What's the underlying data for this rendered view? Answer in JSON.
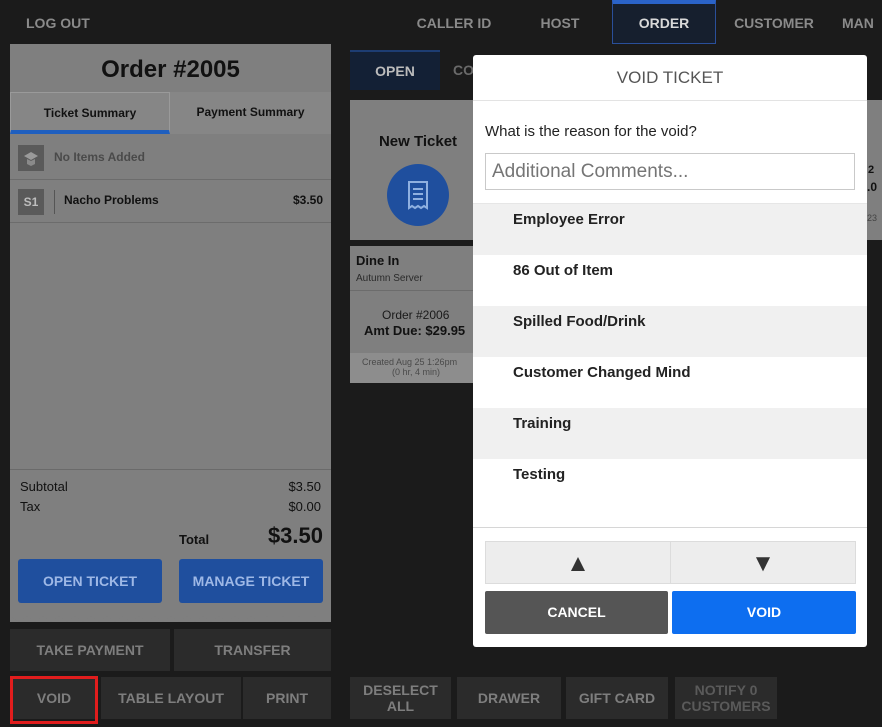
{
  "topnav": {
    "logout": "LOG OUT",
    "tabs": [
      {
        "label": "CALLER ID"
      },
      {
        "label": "HOST"
      },
      {
        "label": "ORDER"
      },
      {
        "label": "CUSTOMER"
      },
      {
        "label": "MAN"
      }
    ]
  },
  "ticket": {
    "title": "Order #2005",
    "tabs": [
      "Ticket Summary",
      "Payment Summary"
    ],
    "no_items": "No Items Added",
    "seat_label": "S1",
    "item_name": "Nacho Problems",
    "item_price": "$3.50",
    "subtotal_label": "Subtotal",
    "subtotal_value": "$3.50",
    "tax_label": "Tax",
    "tax_value": "$0.00",
    "total_label": "Total",
    "total_value": "$3.50",
    "open_ticket": "OPEN TICKET",
    "manage_ticket": "MANAGE TICKET"
  },
  "actions_left": {
    "take_payment": "TAKE PAYMENT",
    "transfer": "TRANSFER",
    "void": "VOID",
    "table_layout": "TABLE LAYOUT",
    "print": "PRINT"
  },
  "actions_right": {
    "deselect_all": "DESELECT ALL",
    "drawer": "DRAWER",
    "gift_card": "GIFT CARD",
    "notify_customers": "NOTIFY 0 CUSTOMERS"
  },
  "background": {
    "status_tab_open": "OPEN",
    "status_tab_partial": "CO",
    "new_ticket": "New Ticket",
    "dine_in": "Dine In",
    "server": "Autumn Server",
    "order_no": "Order #2006",
    "amt_due": "Amt Due: $29.95",
    "created": "Created Aug 25 1:26pm",
    "duration": "(0 hr, 4 min)",
    "partial_1": "2",
    "partial_2": ".0",
    "partial_3": "23"
  },
  "modal": {
    "title": "VOID TICKET",
    "question": "What is the reason for the void?",
    "comments_placeholder": "Additional Comments...",
    "reasons": [
      "Employee Error",
      "86 Out of Item",
      "Spilled Food/Drink",
      "Customer Changed Mind",
      "Training",
      "Testing"
    ],
    "up_arrow": "▲",
    "down_arrow": "▼",
    "cancel": "CANCEL",
    "void": "VOID"
  },
  "colors": {
    "accent_blue": "#0d6ef0",
    "cancel_grey": "#555555",
    "highlight_red": "#e11d1d"
  }
}
